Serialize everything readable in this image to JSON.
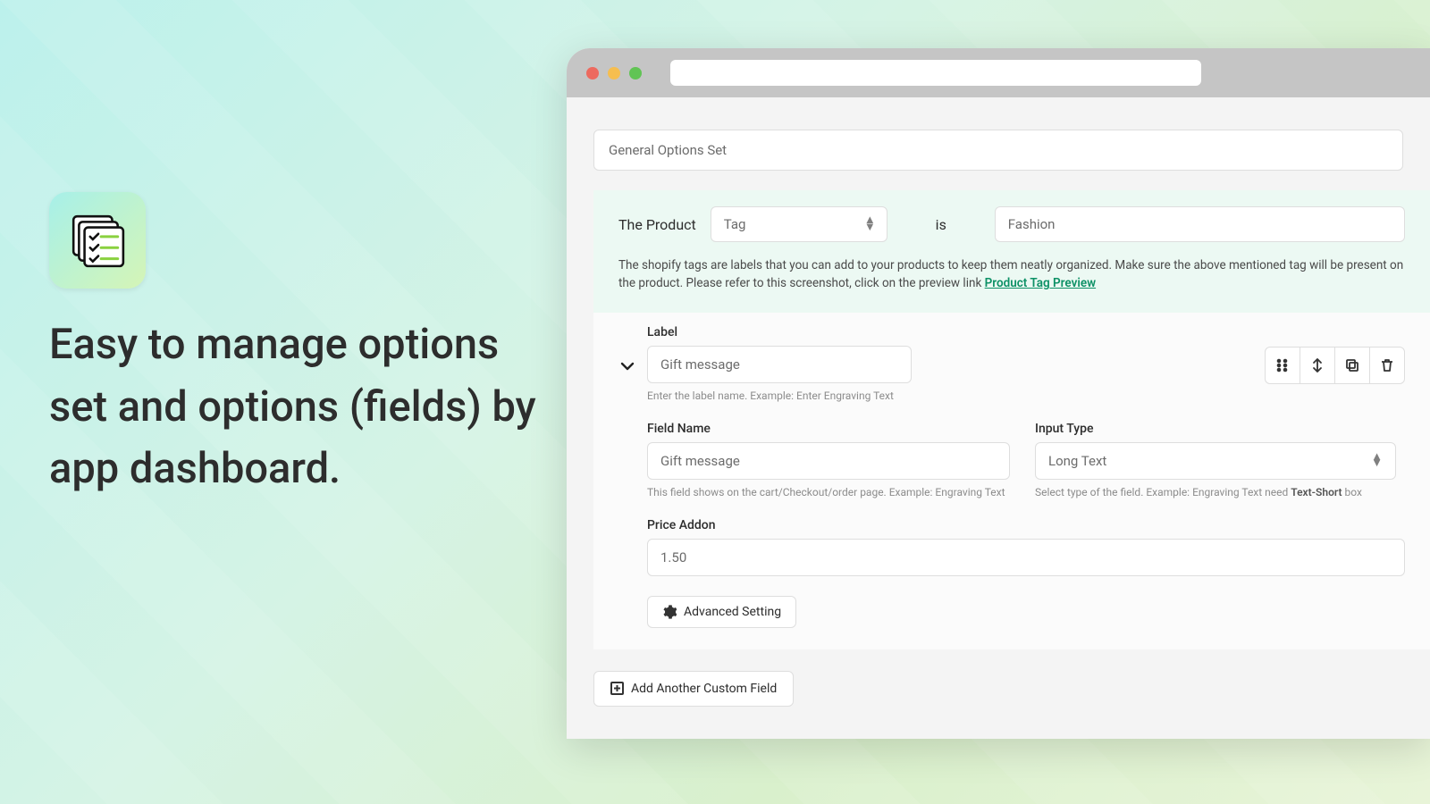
{
  "hero": "Easy to manage options set and options (fields) by app dashboard.",
  "options_set_name": "General Options Set",
  "condition": {
    "prefix": "The Product",
    "selector": "Tag",
    "op": "is",
    "value": "Fashion",
    "help_1": "The shopify tags are labels that you can add to your products to keep them neatly organized. Make sure the above mentioned tag will be present on the product. Please refer to this screenshot, click on the preview link ",
    "help_link": "Product Tag Preview"
  },
  "field": {
    "label_title": "Label",
    "label_value": "Gift message",
    "label_hint": "Enter the label name. Example: Enter Engraving Text",
    "name_title": "Field Name",
    "name_value": "Gift message",
    "name_hint": "This field shows on the cart/Checkout/order page. Example: Engraving Text",
    "type_title": "Input Type",
    "type_value": "Long Text",
    "type_hint_a": "Select type of the field. Example: Engraving Text need ",
    "type_hint_b": "Text-Short",
    "type_hint_c": " box",
    "price_title": "Price Addon",
    "price_value": "1.50"
  },
  "buttons": {
    "advanced": "Advanced Setting",
    "add": "Add Another Custom Field"
  }
}
